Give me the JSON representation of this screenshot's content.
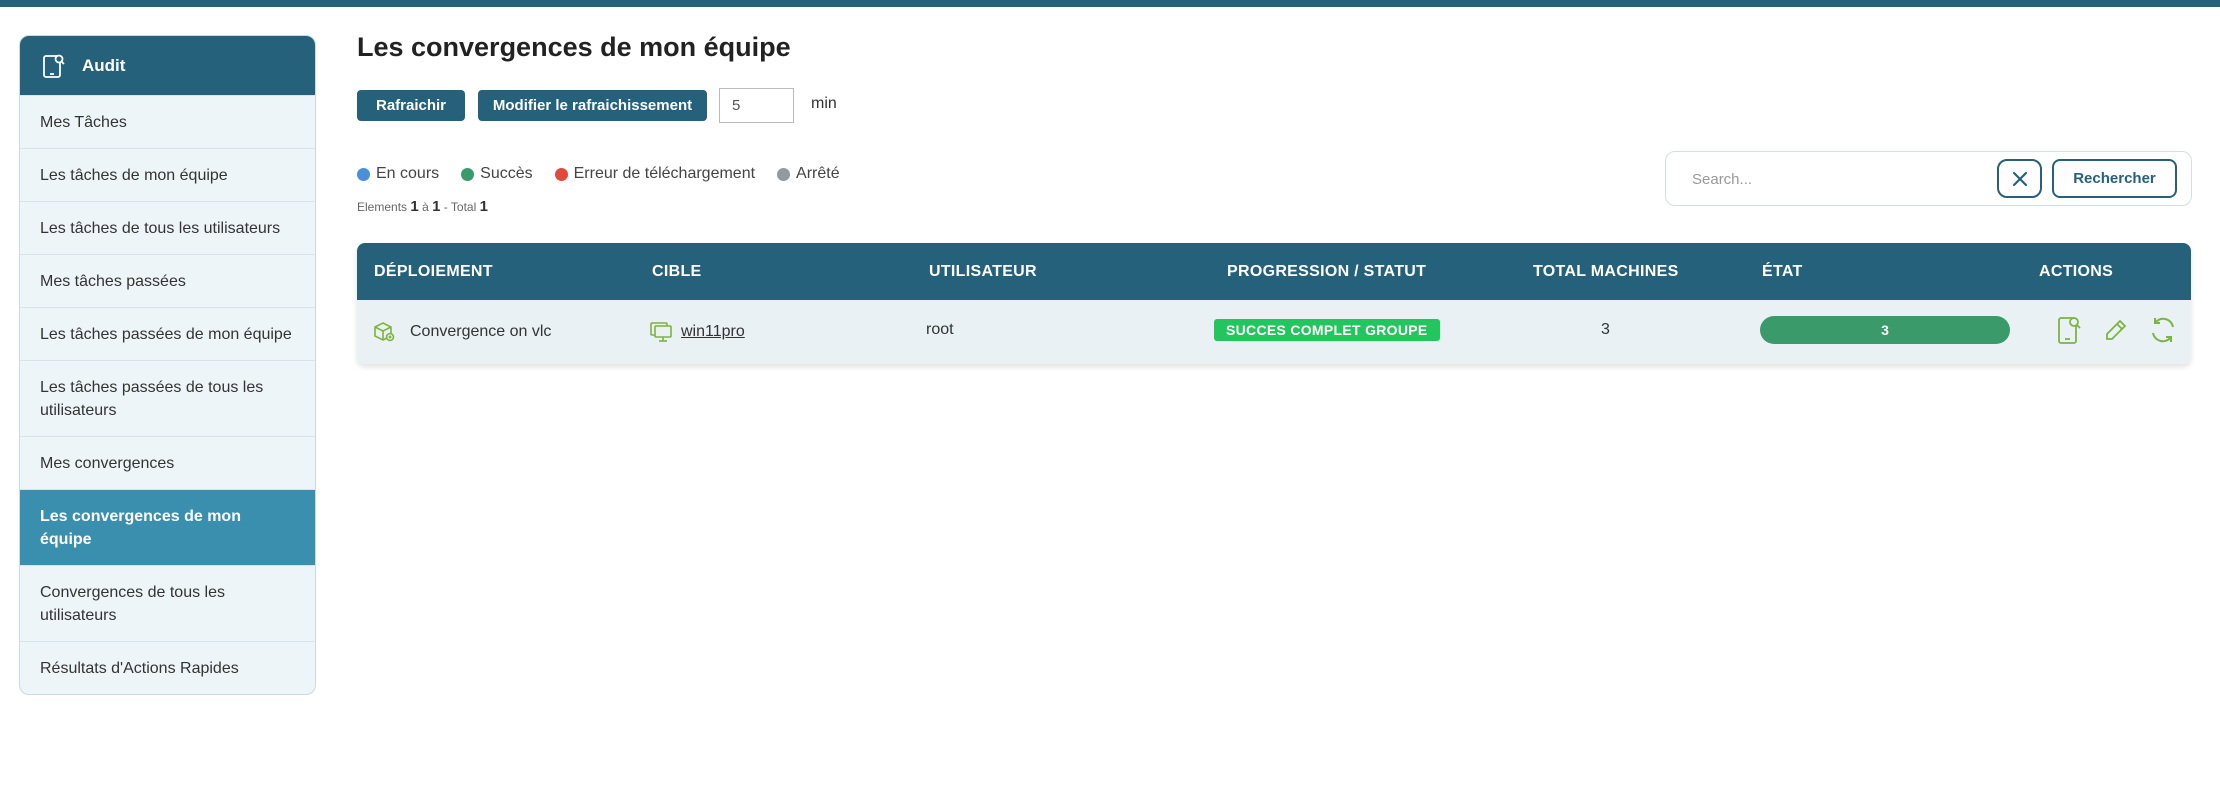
{
  "sidebar": {
    "header": "Audit",
    "items": [
      {
        "label": "Mes Tâches"
      },
      {
        "label": "Les tâches de mon équipe"
      },
      {
        "label": "Les tâches de tous les utilisateurs"
      },
      {
        "label": "Mes tâches passées"
      },
      {
        "label": "Les tâches passées de mon équipe"
      },
      {
        "label": "Les tâches passées de tous les utilisateurs"
      },
      {
        "label": "Mes convergences"
      },
      {
        "label": "Les convergences de mon équipe"
      },
      {
        "label": "Convergences de tous les utilisateurs"
      },
      {
        "label": "Résultats d'Actions Rapides"
      }
    ]
  },
  "main": {
    "title": "Les convergences de mon équipe",
    "refresh_label": "Rafraichir",
    "modify_refresh_label": "Modifier le rafraichissement",
    "refresh_value": "5",
    "refresh_unit": "min"
  },
  "legend": [
    {
      "label": "En cours",
      "color": "#4a90d9"
    },
    {
      "label": "Succès",
      "color": "#3a9a6a"
    },
    {
      "label": "Erreur de téléchargement",
      "color": "#e04a3f"
    },
    {
      "label": "Arrêté",
      "color": "#909a9f"
    }
  ],
  "pagination": {
    "prefix": "Elements",
    "from": "1",
    "sep": "à",
    "to": "1",
    "total_label": "- Total",
    "total": "1"
  },
  "search": {
    "placeholder": "Search...",
    "button_label": "Rechercher"
  },
  "table": {
    "headers": [
      "DÉPLOIEMENT",
      "CIBLE",
      "UTILISATEUR",
      "PROGRESSION / STATUT",
      "TOTAL MACHINES",
      "ÉTAT",
      "ACTIONS"
    ],
    "rows": [
      {
        "deployment": "Convergence on vlc",
        "target": "win11pro",
        "user": "root",
        "status": "SUCCES COMPLET GROUPE",
        "total_machines": "3",
        "state": "3"
      }
    ]
  },
  "colors": {
    "primary": "#25617b",
    "active": "#3b8fae",
    "success": "#22c55e",
    "icon_green": "#7cb342"
  }
}
